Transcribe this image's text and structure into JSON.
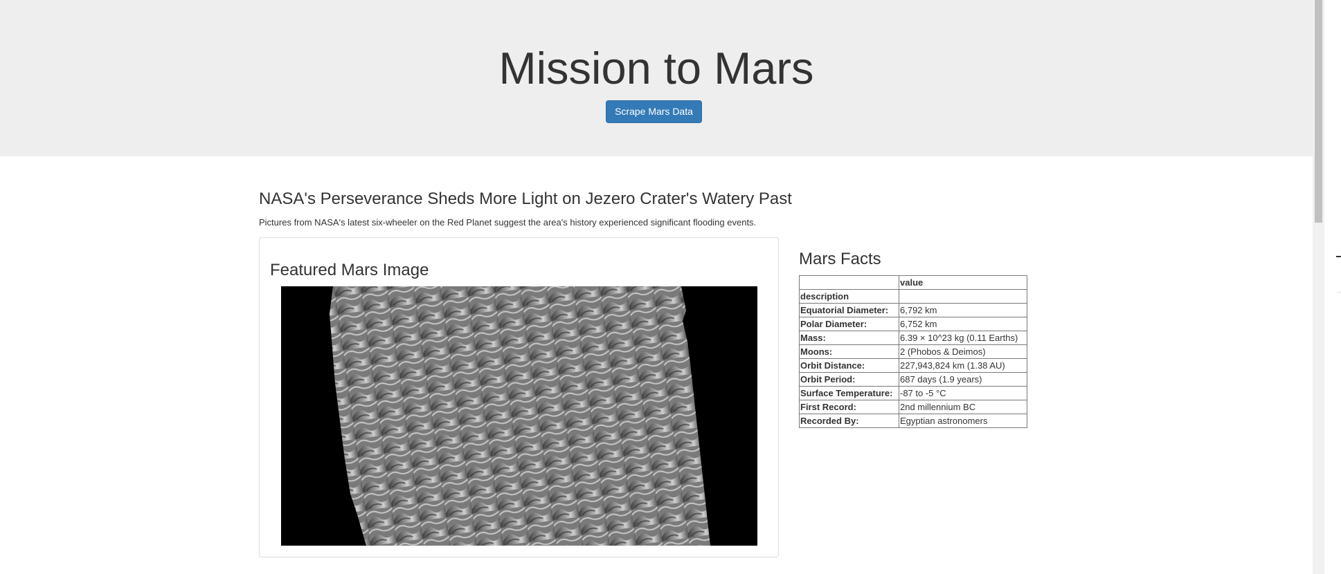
{
  "header": {
    "title": "Mission to Mars",
    "scrape_button_label": "Scrape Mars Data"
  },
  "news": {
    "title": "NASA's Perseverance Sheds More Light on Jezero Crater's Watery Past",
    "teaser": "Pictures from NASA's latest six-wheeler on the Red Planet suggest the area's history experienced significant flooding events."
  },
  "featured_image": {
    "title": "Featured Mars Image"
  },
  "facts": {
    "title": "Mars Facts",
    "header_value": "value",
    "header_description": "description",
    "rows": [
      {
        "label": "Equatorial Diameter:",
        "value": "6,792 km"
      },
      {
        "label": "Polar Diameter:",
        "value": "6,752 km"
      },
      {
        "label": "Mass:",
        "value": "6.39 × 10^23 kg (0.11 Earths)"
      },
      {
        "label": "Moons:",
        "value": "2 (Phobos & Deimos)"
      },
      {
        "label": "Orbit Distance:",
        "value": "227,943,824 km (1.38 AU)"
      },
      {
        "label": "Orbit Period:",
        "value": "687 days (1.9 years)"
      },
      {
        "label": "Surface Temperature:",
        "value": "-87 to -5 °C"
      },
      {
        "label": "First Record:",
        "value": "2nd millennium BC"
      },
      {
        "label": "Recorded By:",
        "value": "Egyptian astronomers"
      }
    ]
  },
  "colors": {
    "jumbotron_bg": "#eeeeee",
    "button_primary": "#337ab7",
    "text": "#333333"
  }
}
